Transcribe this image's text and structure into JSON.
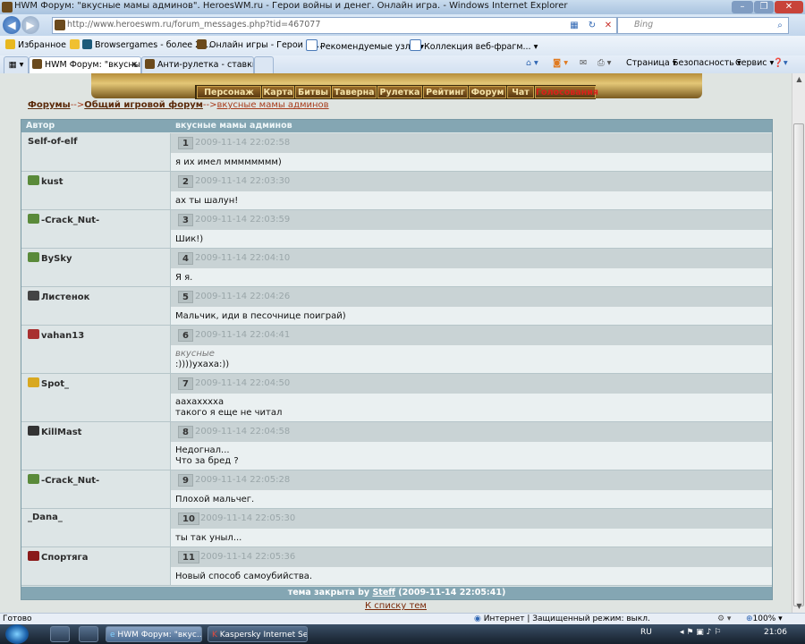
{
  "window": {
    "title": "HWM Форум: \"вкусные мамы админов\". HeroesWM.ru - Герои войны и денег. Онлайн игра. - Windows Internet Explorer"
  },
  "address": {
    "url": "http://www.heroeswm.ru/forum_messages.php?tid=467077",
    "search_placeholder": "Bing"
  },
  "favorites": {
    "label": "Избранное",
    "items": [
      "Browsergames - более 25...",
      "Онлайн игры - Герои Во...",
      "Рекомендуемые узлы",
      "Коллекция веб-фрагм..."
    ]
  },
  "tabs": [
    {
      "label": "HWM Форум: \"вкусны..."
    },
    {
      "label": "Анти-рулетка - ставки - в..."
    }
  ],
  "command_bar": [
    "Страница",
    "Безопасность",
    "Сервис"
  ],
  "game_menu": [
    "Персонаж",
    "Карта",
    "Битвы",
    "Таверна",
    "Рулетка",
    "Рейтинг",
    "Форум",
    "Чат",
    "Голосования"
  ],
  "breadcrumb": {
    "forums": "Форумы",
    "sep1": "-->",
    "section": "Общий игровой форум",
    "sep2": "-->",
    "topic": "вкусные мамы админов"
  },
  "table": {
    "col_author": "Автор",
    "col_topic": "вкусные мамы админов",
    "posts": [
      {
        "author": "Self-of-elf",
        "icon": "none",
        "num": "1",
        "time": "2009-11-14 22:02:58",
        "lines": [
          "я их имел мммммммм)"
        ]
      },
      {
        "author": "kust",
        "icon": "clan-green-icon",
        "num": "2",
        "time": "2009-11-14 22:03:30",
        "lines": [
          "ах ты шалун!"
        ]
      },
      {
        "author": "-Crack_Nut-",
        "icon": "clan-green-icon",
        "num": "3",
        "time": "2009-11-14 22:03:59",
        "lines": [
          "Шик!)"
        ]
      },
      {
        "author": "BySky",
        "icon": "clan-green-icon",
        "num": "4",
        "time": "2009-11-14 22:04:10",
        "lines": [
          "Я я."
        ]
      },
      {
        "author": "Листенок",
        "icon": "clan-shield-icon",
        "num": "5",
        "time": "2009-11-14 22:04:26",
        "lines": [
          "Мальчик, иди в песочнице поиграй)"
        ]
      },
      {
        "author": "vahan13",
        "icon": "clan-hat-icon",
        "num": "6",
        "time": "2009-11-14 22:04:41",
        "quote": "вкусные",
        "lines": [
          ":))))ухаха:))"
        ]
      },
      {
        "author": "Spot_",
        "icon": "clan-crown-icon",
        "num": "7",
        "time": "2009-11-14 22:04:50",
        "lines": [
          "аахахххха",
          "такого я еще не читал"
        ]
      },
      {
        "author": "KillMast",
        "icon": "clan-bird-icon",
        "num": "8",
        "time": "2009-11-14 22:04:58",
        "lines": [
          "Недогнал...",
          "Что за бред ?"
        ]
      },
      {
        "author": "-Crack_Nut-",
        "icon": "clan-green-icon",
        "num": "9",
        "time": "2009-11-14 22:05:28",
        "lines": [
          "Плохой мальчег."
        ]
      },
      {
        "author": "_Dana_",
        "icon": "none",
        "num": "10",
        "time": "2009-11-14 22:05:30",
        "lines": [
          "ты так уныл..."
        ]
      },
      {
        "author": "Спортяга",
        "icon": "clan-red-icon",
        "num": "11",
        "time": "2009-11-14 22:05:36",
        "lines": [
          "Новый способ самоубийства."
        ]
      }
    ],
    "footer_prefix": "тема закрыта by ",
    "footer_user": "Steff",
    "footer_time": " (2009-11-14 22:05:41)",
    "back_link": "К списку тем"
  },
  "status": {
    "left": "Готово",
    "zone": "Интернет | Защищенный режим: выкл.",
    "zoom": "100%"
  },
  "taskbar": {
    "items": [
      "HWM Форум: \"вкус...",
      "Kaspersky Internet Se..."
    ],
    "lang": "RU",
    "clock": "21:06"
  },
  "colors": {
    "table_header": "#84a6b3",
    "meta_row": "#c9d3d5",
    "body_row": "#eaf0f1",
    "author_cell": "#dde5e6",
    "breadcrumb_link": "#5b2a0a",
    "voting_red": "#d8201a"
  }
}
